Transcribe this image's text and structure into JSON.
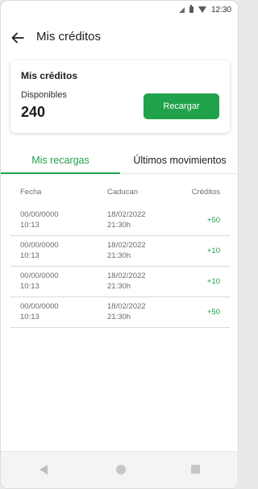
{
  "status_bar": {
    "time": "12:30"
  },
  "app_bar": {
    "title": "Mis créditos"
  },
  "credits_card": {
    "title": "Mis créditos",
    "available_label": "Disponibles",
    "available_value": "240",
    "recharge_label": "Recargar"
  },
  "tabs": [
    {
      "label": "Mis recargas",
      "active": true
    },
    {
      "label": "Últimos movimientos",
      "active": false
    }
  ],
  "table": {
    "headers": {
      "fecha": "Fecha",
      "caducan": "Caducan",
      "creditos": "Créditos"
    },
    "rows": [
      {
        "fecha_date": "00/00/0000",
        "fecha_time": "10:13",
        "caducan_date": "18/02/2022",
        "caducan_time": "21:30h",
        "creditos": "+50"
      },
      {
        "fecha_date": "00/00/0000",
        "fecha_time": "10:13",
        "caducan_date": "18/02/2022",
        "caducan_time": "21:30h",
        "creditos": "+10"
      },
      {
        "fecha_date": "00/00/0000",
        "fecha_time": "10:13",
        "caducan_date": "18/02/2022",
        "caducan_time": "21:30h",
        "creditos": "+10"
      },
      {
        "fecha_date": "00/00/0000",
        "fecha_time": "10:13",
        "caducan_date": "18/02/2022",
        "caducan_time": "21:30h",
        "creditos": "+50"
      }
    ]
  },
  "colors": {
    "accent": "#1fa24a",
    "text": "#1d1d1d",
    "muted": "#6a6a6a"
  }
}
